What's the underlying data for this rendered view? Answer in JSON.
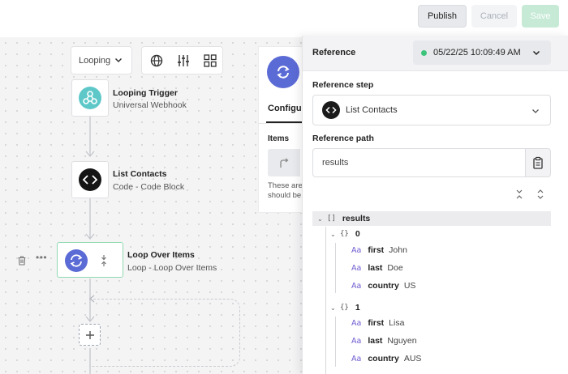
{
  "header": {
    "publish_label": "Publish",
    "cancel_label": "Cancel",
    "save_label": "Save"
  },
  "toolbar": {
    "mode_value": "Looping",
    "tools": [
      "globe-icon",
      "sliders-icon",
      "grid-icon"
    ]
  },
  "flow": {
    "nodes": [
      {
        "title": "Looping Trigger",
        "subtitle": "Universal Webhook",
        "icon": "webhook-icon"
      },
      {
        "title": "List Contacts",
        "subtitle": "Code - Code Block",
        "icon": "code-icon"
      },
      {
        "title": "Loop Over Items",
        "subtitle": "Loop - Loop Over Items",
        "icon": "loop-icon"
      }
    ]
  },
  "config_panel": {
    "tab_label": "Configur",
    "items_label": "Items",
    "help_line1": "These are",
    "help_line2": "should be"
  },
  "reference": {
    "title": "Reference",
    "run_timestamp": "05/22/25 10:09:49 AM",
    "step_label": "Reference step",
    "step_value": "List Contacts",
    "path_label": "Reference path",
    "path_value": "results"
  },
  "tree": {
    "root_type": "[]",
    "root_key": "results",
    "object_type": "{}",
    "string_type": "Aa",
    "items": [
      {
        "index": "0",
        "fields": [
          {
            "key": "first",
            "value": "John"
          },
          {
            "key": "last",
            "value": "Doe"
          },
          {
            "key": "country",
            "value": "US"
          }
        ]
      },
      {
        "index": "1",
        "fields": [
          {
            "key": "first",
            "value": "Lisa"
          },
          {
            "key": "last",
            "value": "Nguyen"
          },
          {
            "key": "country",
            "value": "AUS"
          }
        ]
      }
    ]
  },
  "colors": {
    "accent_green": "#3cc47c",
    "loop_blue": "#5b6bd6",
    "webhook_teal": "#5ec8c9",
    "string_purple": "#6d5bd0"
  }
}
